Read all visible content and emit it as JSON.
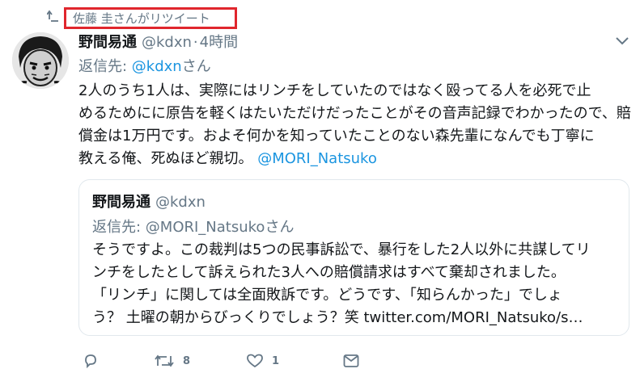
{
  "retweet_banner": {
    "text": "佐藤 圭さんがリツイート"
  },
  "tweet": {
    "author_name": "野間易通",
    "author_handle": "@kdxn",
    "separator": "·",
    "time": "4時間",
    "reply_prefix": "返信先: ",
    "reply_to_handle": "@kdxn",
    "reply_suffix": "さん",
    "text_lines": [
      "2人のうち1人は、実際にはリンチをしていたのではなく殴ってる人を必死で止",
      "めるためにに原告を軽くはたいただけだったことがその音声記録でわかったので、賠",
      "償金は1万円です。およそ何かを知っていたことのない森先輩になんでも丁寧に",
      "教える俺、死ぬほど親切。"
    ],
    "text_mention": "@MORI_Natsuko"
  },
  "quoted_tweet": {
    "author_name": "野間易通",
    "author_handle": "@kdxn",
    "reply_prefix": "返信先: ",
    "reply_to_handle": "@MORI_Natsuko",
    "reply_suffix": "さん",
    "text_lines": [
      "そうですよ。この裁判は5つの民事訴訟で、暴行をした2人以外に共謀してリ",
      "ンチをしたとして訴えられた3人への賠償請求はすべて棄却されました。",
      "「リンチ」に関しては全面敗訴です。どうです、「知らんかった」でしょ",
      "う？ 土曜の朝からびっくりでしょう？笑 twitter.com/MORI_Natsuko/s…"
    ]
  },
  "actions": {
    "reply_count": "",
    "retweet_count": "8",
    "like_count": "1",
    "icons": [
      "reply-icon",
      "retweet-icon",
      "like-icon",
      "message-icon"
    ]
  },
  "colors": {
    "link": "#1b95e0",
    "muted": "#657786",
    "highlight_border": "#e0262d"
  }
}
